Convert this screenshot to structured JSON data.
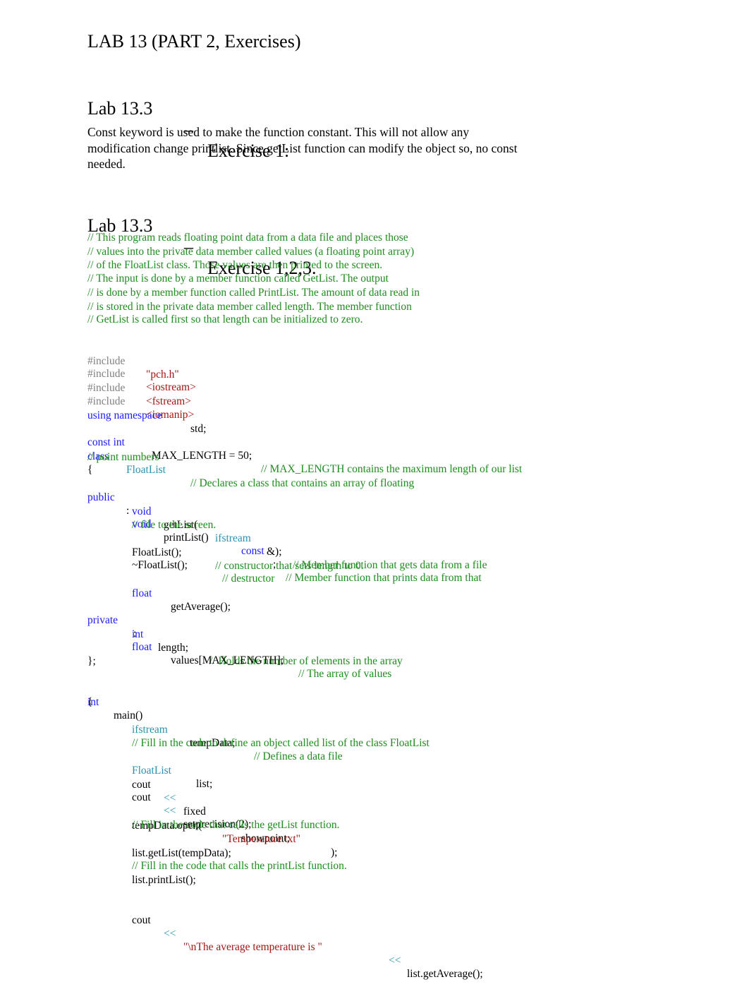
{
  "document": {
    "title": "LAB 13 (PART 2, Exercises)",
    "section1": {
      "lab": "Lab 13.3",
      "dash": "–",
      "exercise": "Exercise 1:"
    },
    "answer_paragraph": "Const keyword is used to make the function constant. This will not allow any modification change printlist. Since getList function can modify the object so, no const needed.",
    "section2": {
      "lab": "Lab 13.3",
      "dash": "–",
      "exercise": "Exercise 1,2,3."
    }
  },
  "colors": {
    "keyword": "#1a1aff",
    "type": "#2b91af",
    "comment": "#1e8c1e",
    "preprocessor": "#808080",
    "string": "#a31515"
  },
  "code": {
    "header_comments": [
      "// This program reads floating point data from a data file and places those",
      "// values into the private data member called values (a floating point array)",
      "// of the FloatList class. Those values are then printed to the screen.",
      "// The input is done by a member function called GetList. The output",
      "// is done by a member function called PrintList. The amount of data read in",
      "// is stored in the private data member called length. The member function",
      "// GetList is called first so that length can be initialized to zero."
    ],
    "includes": [
      {
        "directive": "#include",
        "file": "\"pch.h\""
      },
      {
        "directive": "#include",
        "file": "<iostream>"
      },
      {
        "directive": "#include",
        "file": "<fstream>"
      },
      {
        "directive": "#include",
        "file": "<iomanip>"
      }
    ],
    "using": {
      "keyword": "using namespace",
      "name": "std;"
    },
    "const_line": {
      "keyword": "const int",
      "text": "MAX_LENGTH = 50;",
      "comment": "// MAX_LENGTH contains the maximum length of our list"
    },
    "class_line": {
      "keyword": "class",
      "name": "FloatList",
      "comment": "// Declares a class that contains an array of floating"
    },
    "class_comment2": "// point numbers",
    "open_brace": "{",
    "public_label": {
      "keyword": "public",
      "colon": ":"
    },
    "public_members": {
      "getList": {
        "ret": "void",
        "name": "getList(",
        "param_type": "ifstream",
        "rest": "&);",
        "comment": "// Member function that gets data from a file"
      },
      "printList": {
        "ret": "void",
        "name": "printList()",
        "qualifier": "const",
        "semi": ";",
        "comment": "// Member function that prints data from that"
      },
      "printList_comment2": "// file to the screen.",
      "ctor": {
        "text": "FloatList();",
        "comment": "// constructor that sets length to 0."
      },
      "dtor": {
        "text": "~FloatList();",
        "comment": "// destructor"
      },
      "getAverage": {
        "ret": "float",
        "name": "getAverage();"
      }
    },
    "private_label": {
      "keyword": "private",
      "colon": ":"
    },
    "private_members": {
      "length": {
        "type": "int",
        "name": "length;",
        "comment": "// Holds the number of elements in the array"
      },
      "values": {
        "type": "float",
        "name": "values[MAX_LENGTH];",
        "comment": "// The array of values"
      }
    },
    "class_end": "};",
    "main_sig": {
      "type": "int",
      "name": "main()"
    },
    "main_open": "{",
    "main_body": {
      "tempData_decl": {
        "type": "ifstream",
        "name": "tempData;",
        "comment": "// Defines a data file"
      },
      "comment_define_object": "// Fill in the code to define an object called list of the class FloatList",
      "list_decl": {
        "type": "FloatList",
        "name": "list;"
      },
      "cout1": {
        "cout": "cout",
        "op1": "<<",
        "a": "fixed",
        "op2": "<<",
        "b": "showpoint;"
      },
      "cout2": {
        "cout": "cout",
        "op1": "<<",
        "a": "setprecision(2);"
      },
      "open_call": {
        "text": "tempData.open(",
        "arg": "\"Temperature.txt\"",
        "end": ");"
      },
      "comment_getList": "// Fill in the code that calls the getList function.",
      "getList_call": "list.getList(tempData);",
      "comment_printList": "// Fill in the code that calls the printList function.",
      "printList_call": "list.printList();",
      "cout3": {
        "cout": "cout",
        "op1": "<<",
        "str": "\"\\nThe average temperature is \"",
        "op2": "<<",
        "rest": "list.getAverage();"
      }
    }
  }
}
